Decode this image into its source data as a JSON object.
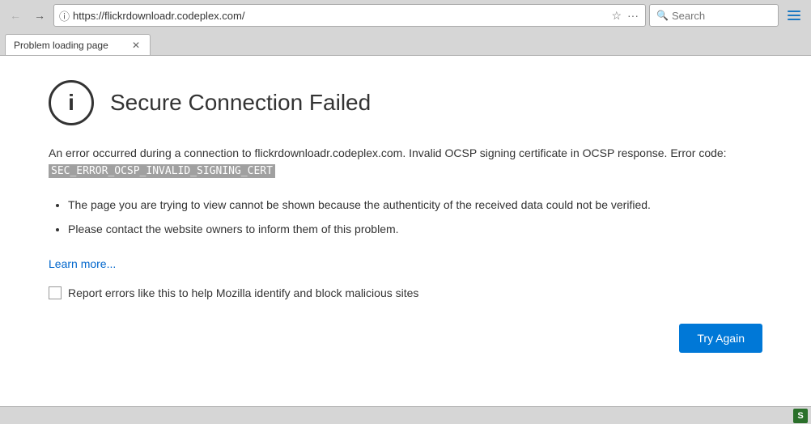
{
  "browser": {
    "url": "https://flickrdownloadr.codeplex.com/",
    "address_placeholder": "https://flickrdownloadr.codeplex.com/",
    "search_placeholder": "Search",
    "tab_label": "Problem loading page",
    "back_btn": "←",
    "forward_btn": "→",
    "star_icon": "☆",
    "more_icon": "···",
    "menu_lines": [
      "",
      "",
      ""
    ],
    "close_tab_icon": "✕"
  },
  "error": {
    "title": "Secure Connection Failed",
    "info_icon": "i",
    "description_before_url": "An error occurred during a connection to flickrdownloadr.codeplex.com. Invalid OCSP signing certificate in OCSP response. Error code:",
    "error_code": "SEC_ERROR_OCSP_INVALID_SIGNING_CERT",
    "bullet1": "The page you are trying to view cannot be shown because the authenticity of the received data could not be verified.",
    "bullet2": "Please contact the website owners to inform them of this problem.",
    "learn_more": "Learn more...",
    "report_label": "Report errors like this to help Mozilla identify and block malicious sites",
    "try_again": "Try Again"
  },
  "statusbar": {
    "icon_label": "S"
  }
}
